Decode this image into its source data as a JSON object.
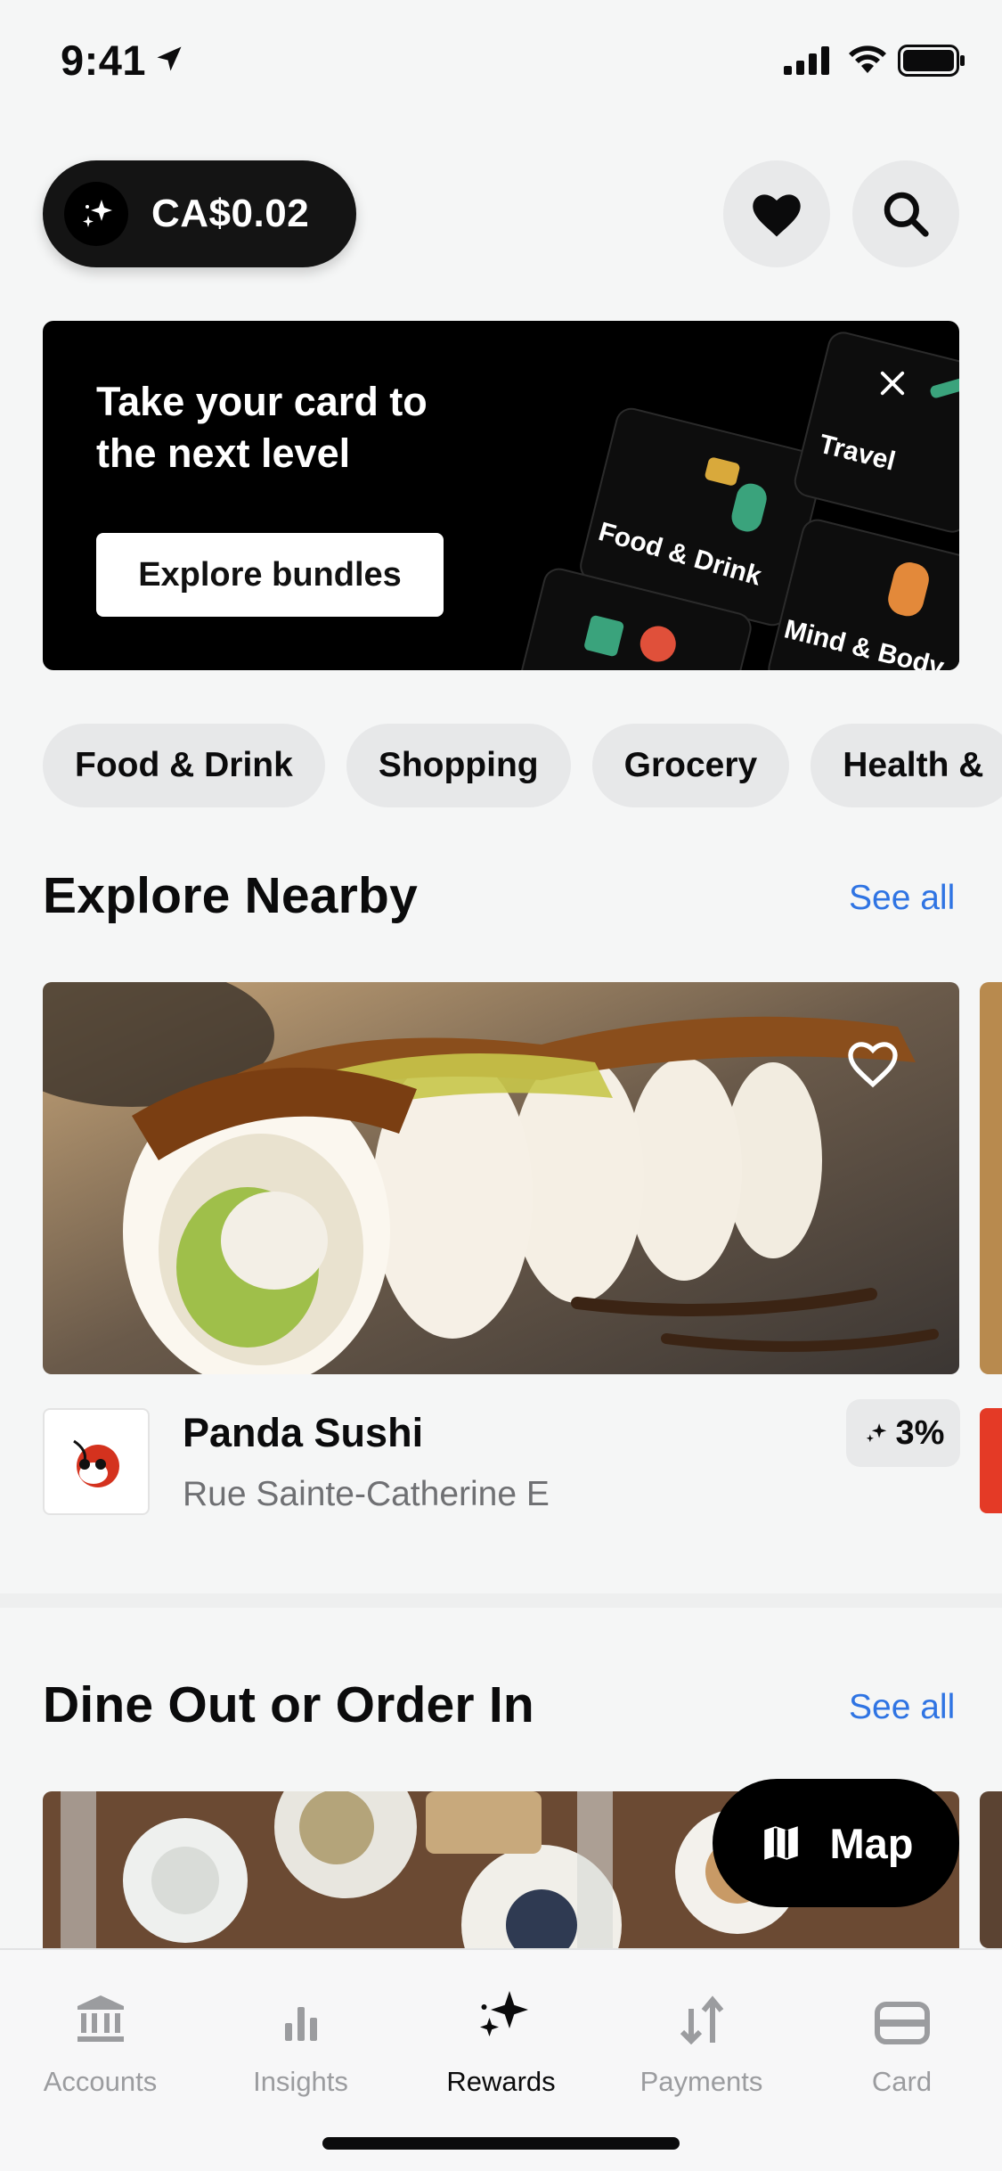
{
  "status_bar": {
    "time": "9:41"
  },
  "header": {
    "balance": "CA$0.02"
  },
  "promo": {
    "headline": "Take your card to the next level",
    "button": "Explore bundles",
    "cards": [
      "Travel",
      "Food & Drink",
      "Mind & Body"
    ]
  },
  "categories": [
    "Food & Drink",
    "Shopping",
    "Grocery",
    "Health &"
  ],
  "explore_nearby": {
    "title": "Explore Nearby",
    "see_all": "See all",
    "merchant": {
      "name": "Panda Sushi",
      "location": "Rue Sainte-Catherine E",
      "cashback": "3%"
    }
  },
  "dine_out": {
    "title": "Dine Out or Order In",
    "see_all": "See all"
  },
  "map_button": "Map",
  "tabs": [
    {
      "label": "Accounts",
      "icon": "bank-icon"
    },
    {
      "label": "Insights",
      "icon": "bar-chart-icon"
    },
    {
      "label": "Rewards",
      "icon": "sparkles-icon",
      "active": true
    },
    {
      "label": "Payments",
      "icon": "transfer-arrows-icon"
    },
    {
      "label": "Card",
      "icon": "card-icon"
    }
  ],
  "colors": {
    "link": "#2f74e3",
    "ink": "#0b0b0c",
    "muted": "#9b9c9f"
  }
}
